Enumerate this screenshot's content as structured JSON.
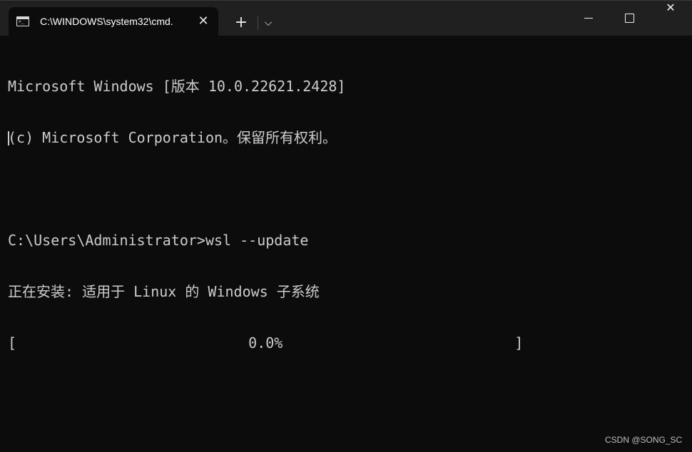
{
  "window": {
    "tab_title": "C:\\WINDOWS\\system32\\cmd.",
    "tab_icon": "cmd-prompt-icon",
    "tab_close_glyph": "✕",
    "new_tab_glyph": "+",
    "dropdown_glyph": "⌵",
    "close_glyph": "✕"
  },
  "console": {
    "lines": [
      "Microsoft Windows [版本 10.0.22621.2428]",
      "(c) Microsoft Corporation。保留所有权利。",
      "",
      "C:\\Users\\Administrator>wsl --update",
      "正在安装: 适用于 Linux 的 Windows 子系统",
      "[                           0.0%                           ]"
    ],
    "progress_percent": 0.0
  },
  "watermark": "CSDN @SONG_SC",
  "colors": {
    "background": "#0c0c0c",
    "titlebar": "#202020",
    "text": "#cccccc"
  }
}
